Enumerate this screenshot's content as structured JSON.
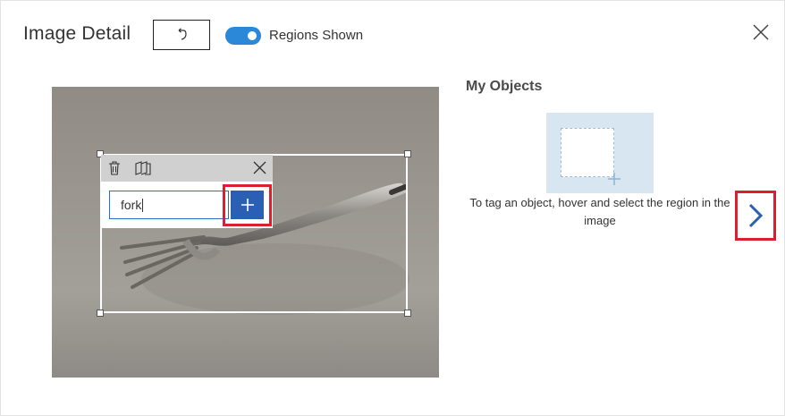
{
  "header": {
    "title": "Image Detail",
    "toggle_label": "Regions Shown",
    "toggle_on": true
  },
  "tag_editor": {
    "input_value": "fork"
  },
  "panel": {
    "heading": "My Objects",
    "hint": "To tag an object, hover and select the region in the image"
  },
  "icons": {
    "undo": "undo-icon",
    "close": "close-icon",
    "delete": "trash-icon",
    "copy": "copy-region-icon",
    "add": "plus-icon",
    "next": "chevron-right-icon"
  },
  "colors": {
    "accent": "#2b5fb3",
    "toggle": "#2b88d8",
    "highlight": "#d8202f",
    "placeholder": "#d8e6f2"
  }
}
